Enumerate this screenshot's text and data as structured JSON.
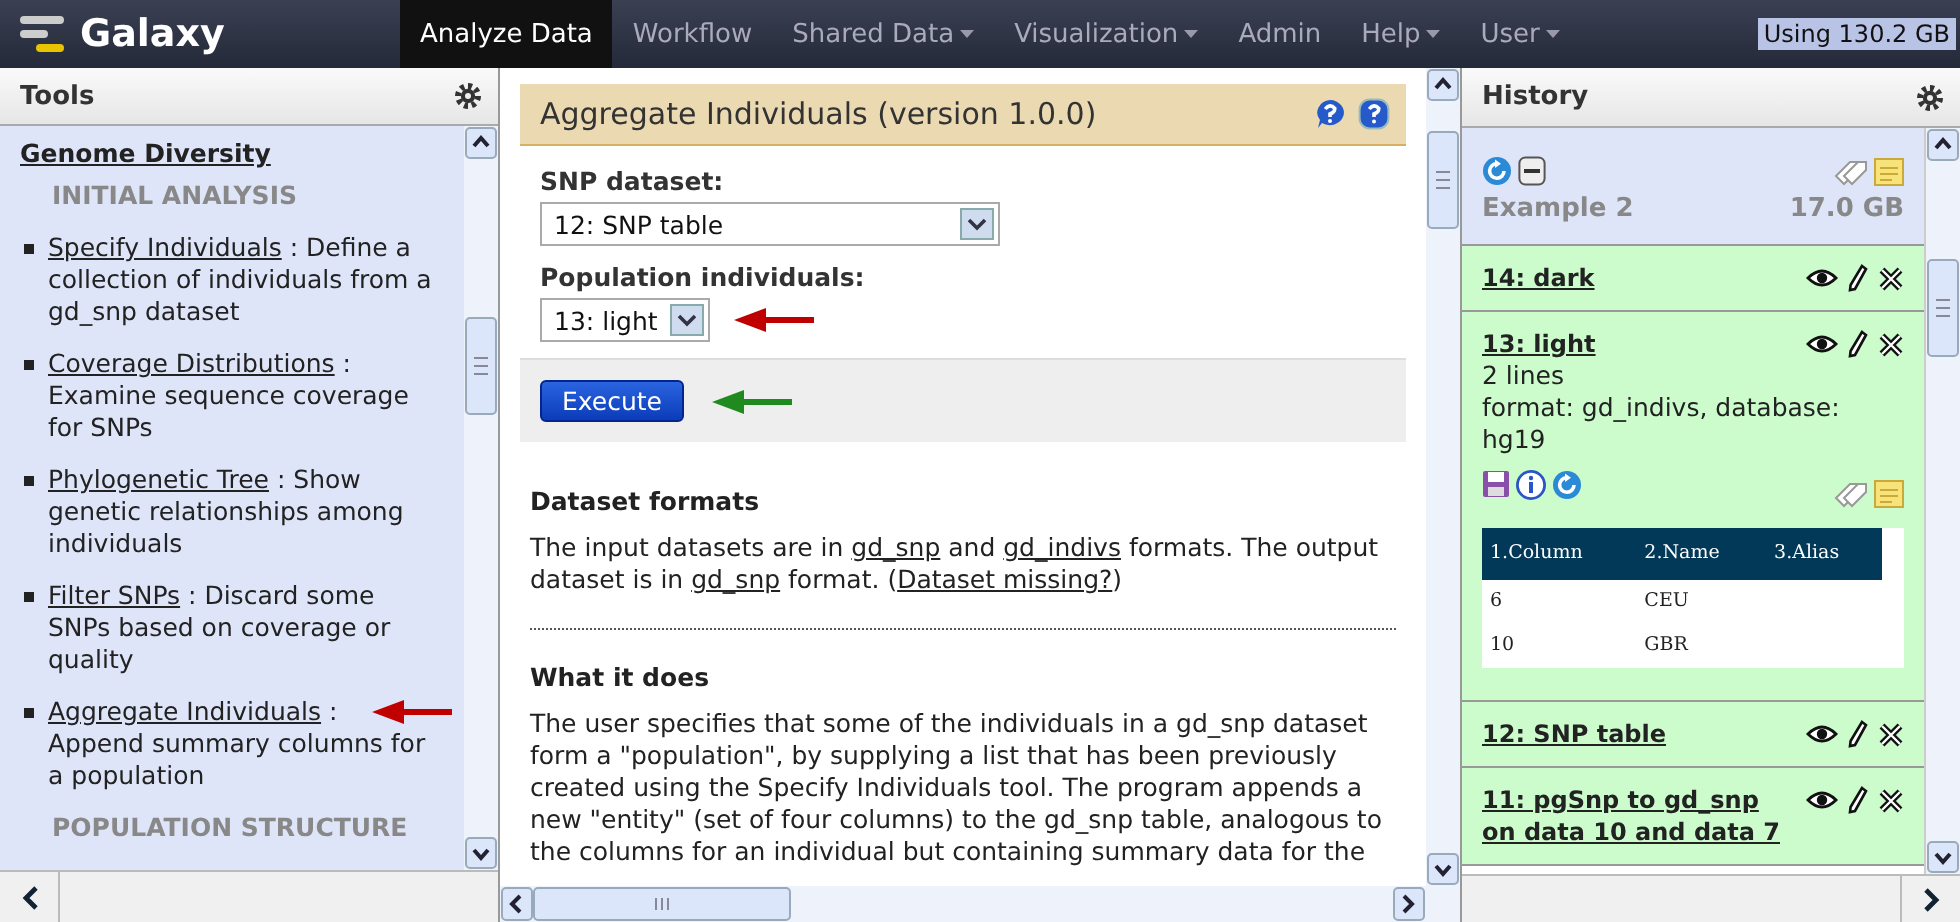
{
  "masthead": {
    "brand": "Galaxy",
    "tabs": [
      {
        "label": "Analyze Data",
        "selected": true,
        "dropdown": false
      },
      {
        "label": "Workflow",
        "selected": false,
        "dropdown": false
      },
      {
        "label": "Shared Data",
        "selected": false,
        "dropdown": true
      },
      {
        "label": "Visualization",
        "selected": false,
        "dropdown": true
      },
      {
        "label": "Admin",
        "selected": false,
        "dropdown": false
      },
      {
        "label": "Help",
        "selected": false,
        "dropdown": true
      },
      {
        "label": "User",
        "selected": false,
        "dropdown": true
      }
    ],
    "usage": "Using 130.2 GB"
  },
  "tools": {
    "title": "Tools",
    "section": "Genome Diversity",
    "items": [
      {
        "kind": "label",
        "text": "INITIAL ANALYSIS"
      },
      {
        "kind": "tool",
        "name": "Specify Individuals",
        "description": " : Define a collection of individuals from a gd_snp dataset",
        "marked": false
      },
      {
        "kind": "tool",
        "name": "Coverage Distributions",
        "description": " : Examine sequence coverage for SNPs",
        "marked": false
      },
      {
        "kind": "tool",
        "name": "Phylogenetic Tree",
        "description": " : Show genetic relationships among individuals",
        "marked": false
      },
      {
        "kind": "tool",
        "name": "Filter SNPs",
        "description": " : Discard some SNPs based on coverage or quality",
        "marked": false
      },
      {
        "kind": "tool",
        "name": "Aggregate Individuals",
        "description": " : Append summary columns for a population",
        "marked": true
      },
      {
        "kind": "label",
        "text": "POPULATION STRUCTURE"
      }
    ]
  },
  "tool_form": {
    "title": "Aggregate Individuals (version 1.0.0)",
    "fields": [
      {
        "label": "SNP dataset:",
        "value": "12: SNP table",
        "marked": false
      },
      {
        "label": "Population individuals:",
        "value": "13: light",
        "marked": true
      }
    ],
    "execute": {
      "label": "Execute",
      "marked": true
    },
    "help": [
      {
        "heading": "Dataset formats",
        "parts": [
          {
            "kind": "text",
            "text": "The input datasets are in "
          },
          {
            "kind": "link",
            "text": "gd_snp"
          },
          {
            "kind": "text",
            "text": " and "
          },
          {
            "kind": "link",
            "text": "gd_indivs"
          },
          {
            "kind": "text",
            "text": " formats. The output dataset is in "
          },
          {
            "kind": "link",
            "text": "gd_snp"
          },
          {
            "kind": "text",
            "text": " format. ("
          },
          {
            "kind": "link",
            "text": "Dataset missing?"
          },
          {
            "kind": "text",
            "text": ")"
          }
        ]
      },
      {
        "heading": "What it does",
        "parts": [
          {
            "kind": "text",
            "text": "The user specifies that some of the individuals in a gd_snp dataset form a \"population\", by supplying a list that has been previously created using the Specify Individuals tool. The program appends a new \"entity\" (set of four columns) to the gd_snp table, analogous to the columns for an individual but containing summary data for the"
          }
        ]
      }
    ]
  },
  "history": {
    "title": "History",
    "name": "Example 2",
    "size": "17.0 GB",
    "datasets": [
      {
        "title": "14: dark",
        "expanded": false
      },
      {
        "title": "13: light",
        "expanded": true,
        "lines": "2 lines",
        "info": "format: gd_indivs, database: hg19",
        "peek": {
          "columns": [
            "1.Column",
            "2.Name",
            "3.Alias"
          ],
          "rows": [
            [
              "6",
              "CEU"
            ],
            [
              "10",
              "GBR"
            ]
          ]
        }
      },
      {
        "title": "12: SNP table",
        "expanded": false
      },
      {
        "title": "11: pgSnp to gd_snp on data 10 and data 7",
        "expanded": false
      }
    ]
  }
}
